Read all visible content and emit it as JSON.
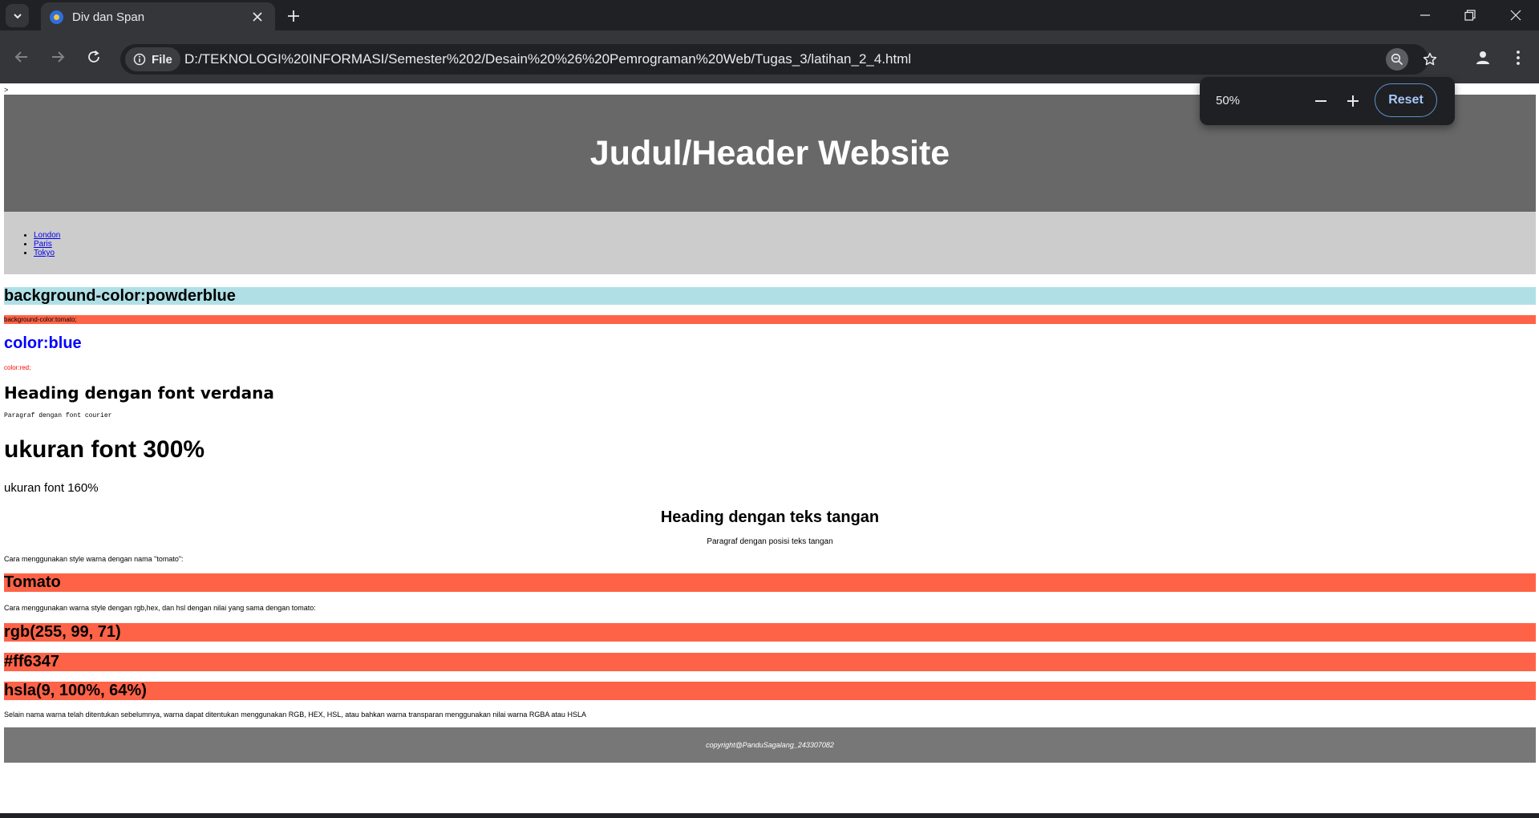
{
  "browser": {
    "tab_title": "Div dan Span",
    "url": "D:/TEKNOLOGI%20INFORMASI/Semester%202/Desain%20%26%20Pemrograman%20Web/Tugas_3/latihan_2_4.html",
    "site_info_label": "File",
    "zoom": {
      "level": "50%",
      "reset_label": "Reset"
    }
  },
  "page": {
    "stray_text": ">",
    "header_title": "Judul/Header Website",
    "nav_links": [
      "London",
      "Paris",
      "Tokyo"
    ],
    "powderblue_heading": "background-color:powderblue",
    "tomato_paragraph": "background-color:tomato;",
    "blue_heading": "color:blue",
    "red_paragraph": "color:red;",
    "verdana_heading": "Heading dengan font verdana",
    "courier_paragraph": "Paragraf dengan font courier",
    "font300": "ukuran font 300%",
    "font160": "ukuran font 160%",
    "center_heading": "Heading dengan teks tangan",
    "center_paragraph": "Paragraf dengan posisi teks tangan",
    "tomato_intro": "Cara menggunakan style warna dengan nama \"tomato\":",
    "tomato_name": "Tomato",
    "variants_intro": "Cara menggunakan warna style dengan rgb,hex, dan hsl dengan nilai yang sama dengan tomato:",
    "rgb_value": "rgb(255, 99, 71)",
    "hex_value": "#ff6347",
    "hsla_value": "hsla(9, 100%, 64%)",
    "closing_paragraph": "Selain nama warna telah ditentukan sebelumnya, warna dapat ditentukan menggunakan RGB, HEX, HSL, atau bahkan warna transparan menggunakan nilai warna RGBA atau HSLA",
    "footer_text": "copyright@PanduSagalang_243307082"
  },
  "colors": {
    "tomato": "#ff6347",
    "powderblue": "#b0e0e6",
    "header_bg": "#686868",
    "nav_bg": "#cccccc",
    "footer_bg": "#777777"
  }
}
